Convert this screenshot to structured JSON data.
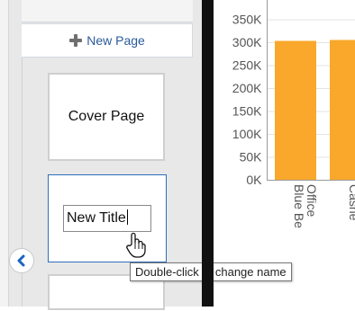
{
  "left_panel": {
    "new_page_label": "New Page",
    "pages": [
      {
        "label": "Cover Page"
      },
      {
        "label": "New Title"
      }
    ],
    "tooltip": "Double-click to change name"
  },
  "colors": {
    "bar": "#f9a82b",
    "link": "#2a5a9a",
    "selection_border": "#2d6fbd"
  },
  "chart_data": {
    "type": "bar",
    "categories": [
      "Blue Be Office",
      "Cashe Office"
    ],
    "values": [
      303000,
      305000
    ],
    "y_ticks": [
      "0K",
      "50K",
      "100K",
      "150K",
      "200K",
      "250K",
      "300K",
      "350K"
    ],
    "ylim": [
      0,
      350000
    ],
    "grid": true
  }
}
